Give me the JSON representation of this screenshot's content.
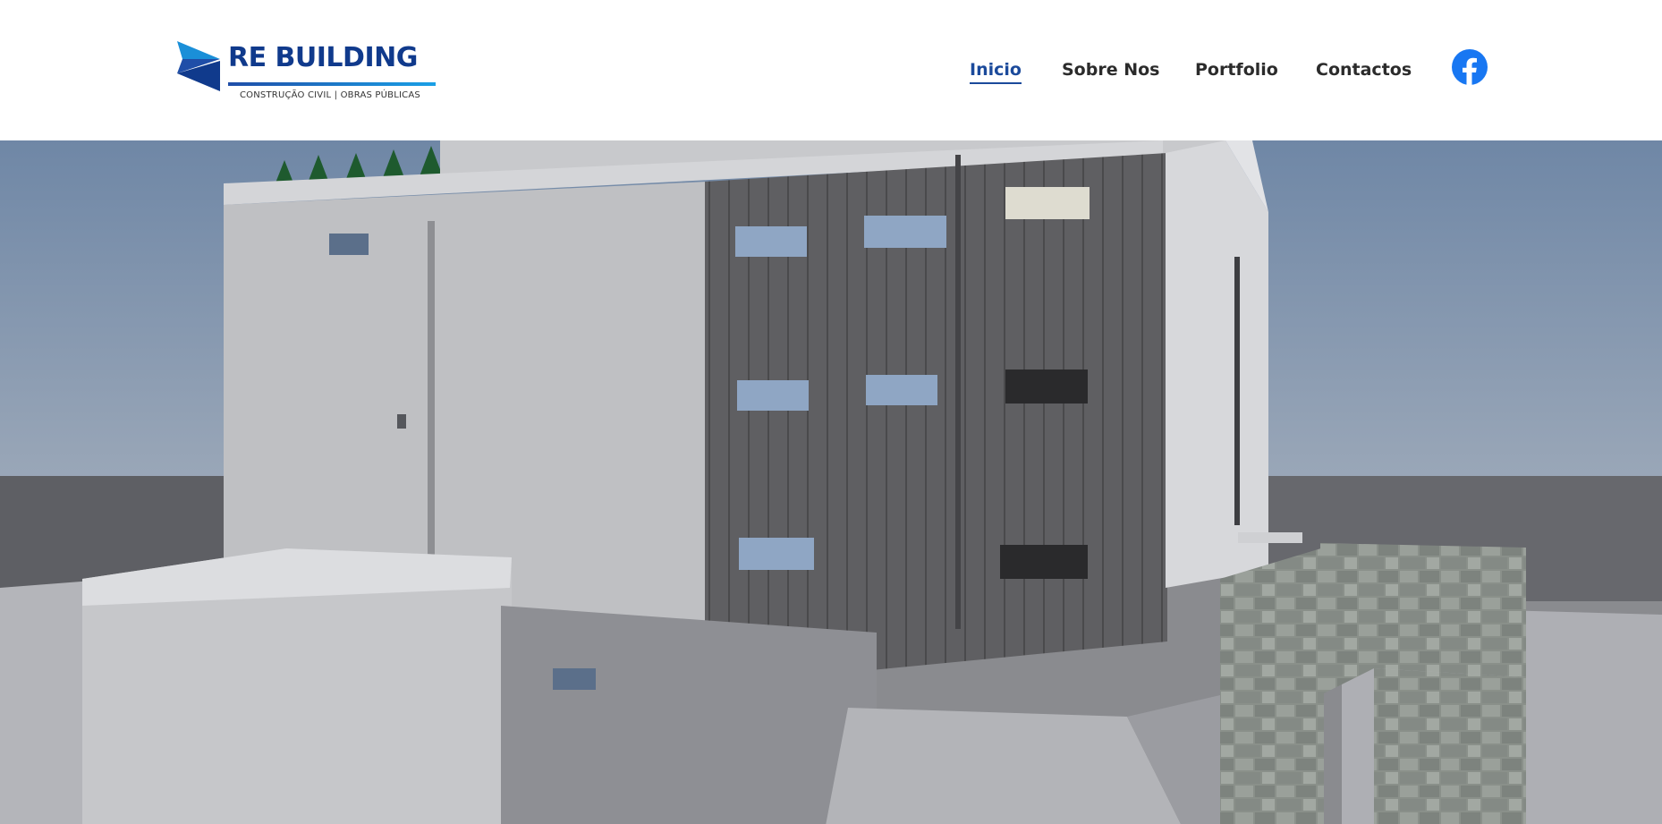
{
  "header": {
    "logo": {
      "name": "RE BUILDING",
      "tagline": "CONSTRUÇÃO CIVIL | OBRAS PÚBLICAS"
    },
    "nav": [
      {
        "label": "Inicio",
        "active": true
      },
      {
        "label": "Sobre Nos",
        "active": false
      },
      {
        "label": "Portfolio",
        "active": false
      },
      {
        "label": "Contactos",
        "active": false
      }
    ],
    "social": {
      "icon": "facebook-icon"
    }
  },
  "hero": {
    "image": "3D architectural render of an industrial building with grey metal cladding and a stone retaining wall"
  },
  "colors": {
    "brand_blue": "#103a8c",
    "accent_blue": "#1aa0e6",
    "facebook_blue": "#1877f2",
    "nav_text": "#2b2b2b",
    "active_nav": "#1b4a9b"
  }
}
